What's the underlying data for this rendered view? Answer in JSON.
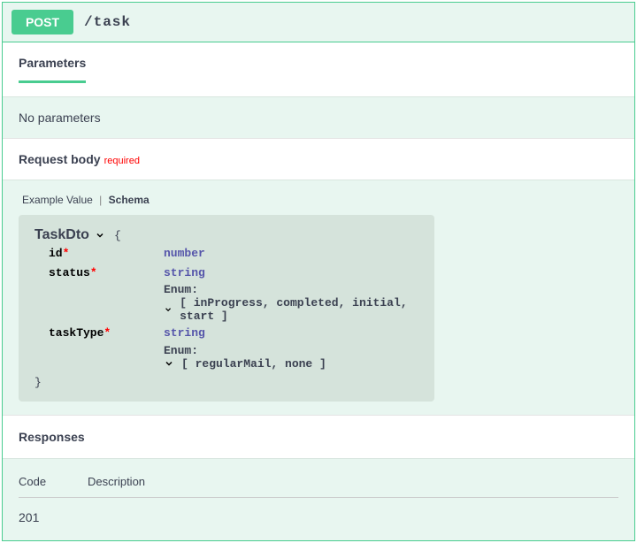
{
  "method": "POST",
  "path": "/task",
  "parameters": {
    "heading": "Parameters",
    "empty": "No parameters"
  },
  "requestBody": {
    "heading": "Request body",
    "requiredTag": "required",
    "tabs": {
      "example": "Example Value",
      "schema": "Schema"
    },
    "model": {
      "name": "TaskDto",
      "open": "{",
      "close": "}",
      "props": [
        {
          "name": "id",
          "required": true,
          "type": "number"
        },
        {
          "name": "status",
          "required": true,
          "type": "string",
          "enumLabel": "Enum:",
          "enum": "[ inProgress, completed, initial, start ]"
        },
        {
          "name": "taskType",
          "required": true,
          "type": "string",
          "enumLabel": "Enum:",
          "enum": "[ regularMail, none ]"
        }
      ]
    }
  },
  "responses": {
    "heading": "Responses",
    "columns": {
      "code": "Code",
      "desc": "Description"
    },
    "rows": [
      {
        "code": "201",
        "desc": ""
      }
    ]
  }
}
